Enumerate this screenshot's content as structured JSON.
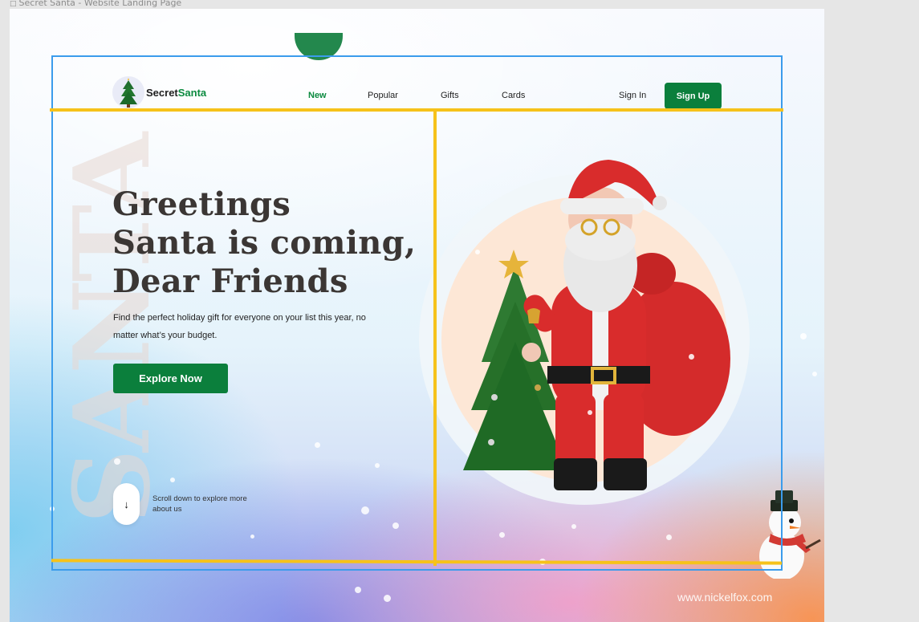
{
  "frame": {
    "label": "Secret Santa - Website Landing Page",
    "icon": "frame-icon"
  },
  "brand": {
    "name_part1": "Secret",
    "name_part2": "Santa",
    "accent_color": "#0b8a3f",
    "logo_icon": "christmas-tree-icon"
  },
  "nav": {
    "items": [
      {
        "label": "New",
        "active": true
      },
      {
        "label": "Popular",
        "active": false
      },
      {
        "label": "Gifts",
        "active": false
      },
      {
        "label": "Cards",
        "active": false
      }
    ],
    "sign_in": "Sign In",
    "sign_up": "Sign Up"
  },
  "hero": {
    "title_lines": [
      "Greetings",
      "Santa is coming,",
      "Dear Friends"
    ],
    "subtitle": "Find the perfect holiday gift for everyone on your list this year, no matter what’s your budget.",
    "cta": "Explore Now",
    "scroll_icon": "arrow-down-icon",
    "scroll_text": "Scroll down to explore more about us",
    "watermark": "SANTA"
  },
  "illustration": {
    "icon": "santa-illustration",
    "secondary_icon": "snowman-icon"
  },
  "footer": {
    "credit": "www.nickelfox.com"
  },
  "colors": {
    "primary_green": "#0b7f3c",
    "title_text": "#3b3634",
    "selection_blue": "#3b9cec",
    "guide_yellow": "#f6c21a"
  }
}
